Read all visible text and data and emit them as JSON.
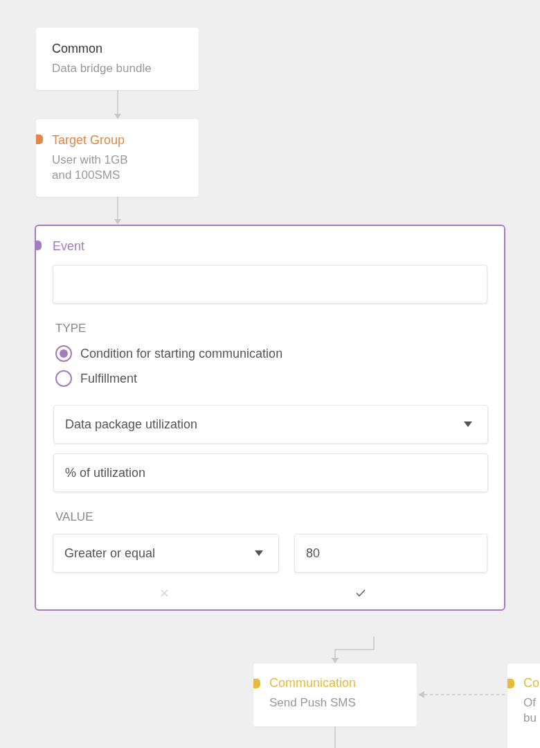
{
  "nodes": [
    {
      "title": "Common",
      "subtitle": "Data bridge bundle"
    },
    {
      "title": "Target Group",
      "subtitle": "User with 1GB\nand 100SMS",
      "color": "#e0874a"
    }
  ],
  "event": {
    "title": "Event",
    "color": "#a67bbd",
    "type_label": "TYPE",
    "type_options": [
      {
        "label": "Condition for starting communication",
        "selected": true
      },
      {
        "label": "Fulfillment",
        "selected": false
      }
    ],
    "metric_select": {
      "value": "Data package utilization"
    },
    "unit_field": {
      "value": "% of utilization"
    },
    "value_label": "VALUE",
    "operator_select": {
      "value": "Greater or equal"
    },
    "threshold_field": {
      "value": "80"
    }
  },
  "bottom_nodes": [
    {
      "title": "Communication",
      "subtitle": "Send Push SMS",
      "color": "#e6bc3c"
    },
    {
      "title": "Co",
      "subtitle": "Of\nbu",
      "color": "#e6bc3c"
    }
  ]
}
